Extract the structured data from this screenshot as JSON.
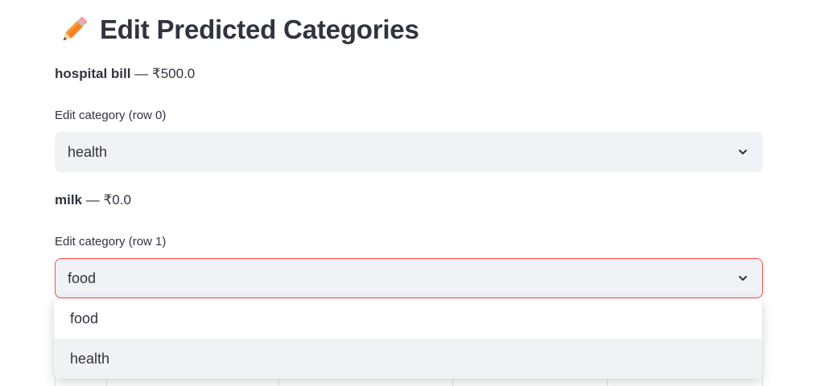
{
  "page": {
    "title": "Edit Predicted Categories",
    "title_icon": "pencil-icon"
  },
  "rows": [
    {
      "name": "hospital bill",
      "amount": " — ₹500.0",
      "label": "Edit category (row 0)",
      "selected": "health"
    },
    {
      "name": "milk",
      "amount": " — ₹0.0",
      "label": "Edit category (row 1)",
      "selected": "food"
    }
  ],
  "dropdown": {
    "options": [
      "food",
      "health"
    ],
    "hovered": "health"
  },
  "colors": {
    "text": "#31333f",
    "input_bg": "#f0f2f6",
    "focus_border": "#ff4b4b"
  }
}
